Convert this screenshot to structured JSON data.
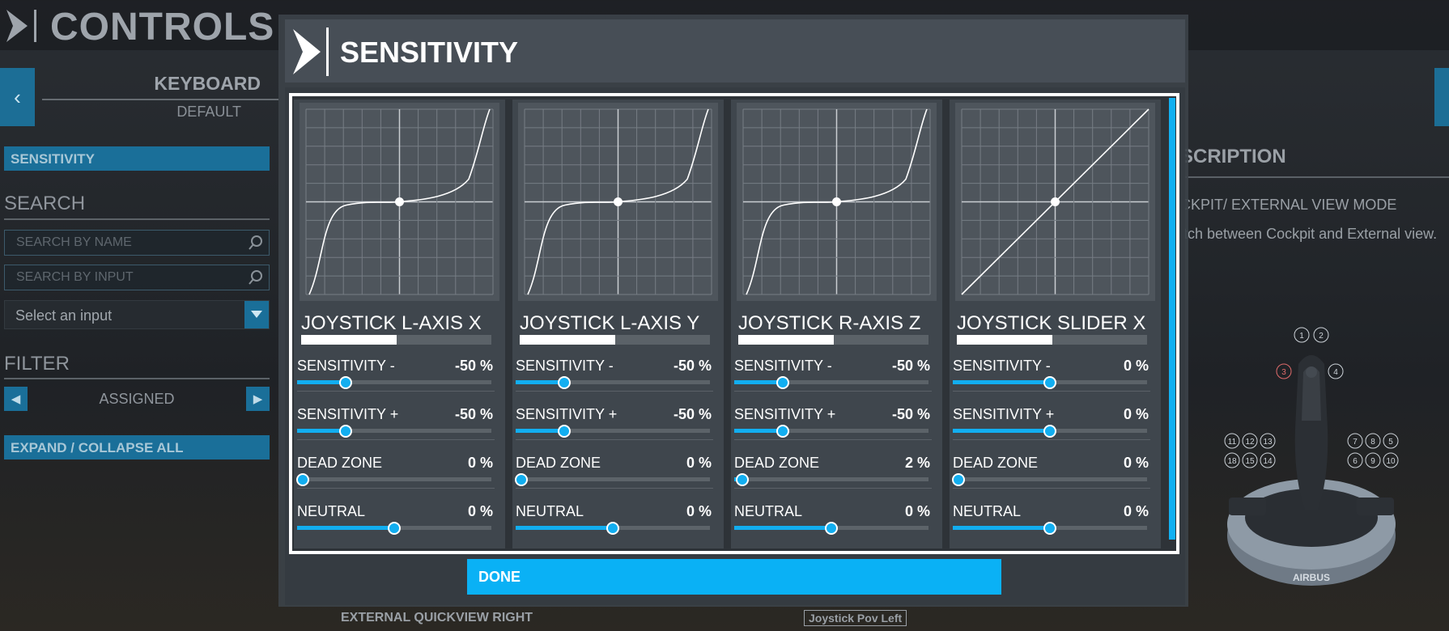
{
  "page": {
    "title": "CONTROLS",
    "profile": {
      "device": "KEYBOARD",
      "preset": "DEFAULT"
    },
    "sidebar": {
      "sensitivity_button": "SENSITIVITY",
      "search_heading": "SEARCH",
      "search_by_name_placeholder": "SEARCH BY NAME",
      "search_by_input_placeholder": "SEARCH BY INPUT",
      "select_input": "Select an input",
      "filter_heading": "FILTER",
      "filter_value": "ASSIGNED",
      "expand_collapse": "EXPAND / COLLAPSE ALL"
    },
    "description": {
      "title": "SCRIPTION",
      "line1": "CKPIT/ EXTERNAL VIEW MODE",
      "line2": "itch between Cockpit and External view."
    },
    "joystick_labels": {
      "top": [
        "1",
        "2"
      ],
      "hat_left": "3",
      "hat_right": "4",
      "left_group": [
        "11",
        "12",
        "13",
        "18",
        "15",
        "14"
      ],
      "right_group": [
        "7",
        "8",
        "5",
        "6",
        "9",
        "10"
      ],
      "brand": "AIRBUS"
    },
    "bottom": {
      "binding_name": "EXTERNAL QUICKVIEW RIGHT",
      "binding_input": "Joystick Pov Left"
    }
  },
  "modal": {
    "title": "SENSITIVITY",
    "done_label": "DONE",
    "axes": [
      {
        "name": "JOYSTICK L-AXIS X",
        "curve": "scurve",
        "input_level": 0.5,
        "params": [
          {
            "label": "SENSITIVITY -",
            "value": "-50 %",
            "level": 0.25
          },
          {
            "label": "SENSITIVITY +",
            "value": "-50 %",
            "level": 0.25
          },
          {
            "label": "DEAD ZONE",
            "value": "0 %",
            "level": 0.0
          },
          {
            "label": "NEUTRAL",
            "value": "0 %",
            "level": 0.5
          }
        ]
      },
      {
        "name": "JOYSTICK L-AXIS Y",
        "curve": "scurve",
        "input_level": 0.5,
        "params": [
          {
            "label": "SENSITIVITY -",
            "value": "-50 %",
            "level": 0.25
          },
          {
            "label": "SENSITIVITY +",
            "value": "-50 %",
            "level": 0.25
          },
          {
            "label": "DEAD ZONE",
            "value": "0 %",
            "level": 0.0
          },
          {
            "label": "NEUTRAL",
            "value": "0 %",
            "level": 0.5
          }
        ]
      },
      {
        "name": "JOYSTICK R-AXIS Z",
        "curve": "scurve",
        "input_level": 0.5,
        "params": [
          {
            "label": "SENSITIVITY -",
            "value": "-50 %",
            "level": 0.25
          },
          {
            "label": "SENSITIVITY +",
            "value": "-50 %",
            "level": 0.25
          },
          {
            "label": "DEAD ZONE",
            "value": "2 %",
            "level": 0.04
          },
          {
            "label": "NEUTRAL",
            "value": "0 %",
            "level": 0.5
          }
        ]
      },
      {
        "name": "JOYSTICK SLIDER X",
        "curve": "linear",
        "input_level": 0.5,
        "params": [
          {
            "label": "SENSITIVITY -",
            "value": "0 %",
            "level": 0.5
          },
          {
            "label": "SENSITIVITY +",
            "value": "0 %",
            "level": 0.5
          },
          {
            "label": "DEAD ZONE",
            "value": "0 %",
            "level": 0.0
          },
          {
            "label": "NEUTRAL",
            "value": "0 %",
            "level": 0.5
          }
        ]
      }
    ]
  },
  "colors": {
    "accent": "#12aef0",
    "done": "#0ab1f5",
    "panel": "#3f464d"
  }
}
